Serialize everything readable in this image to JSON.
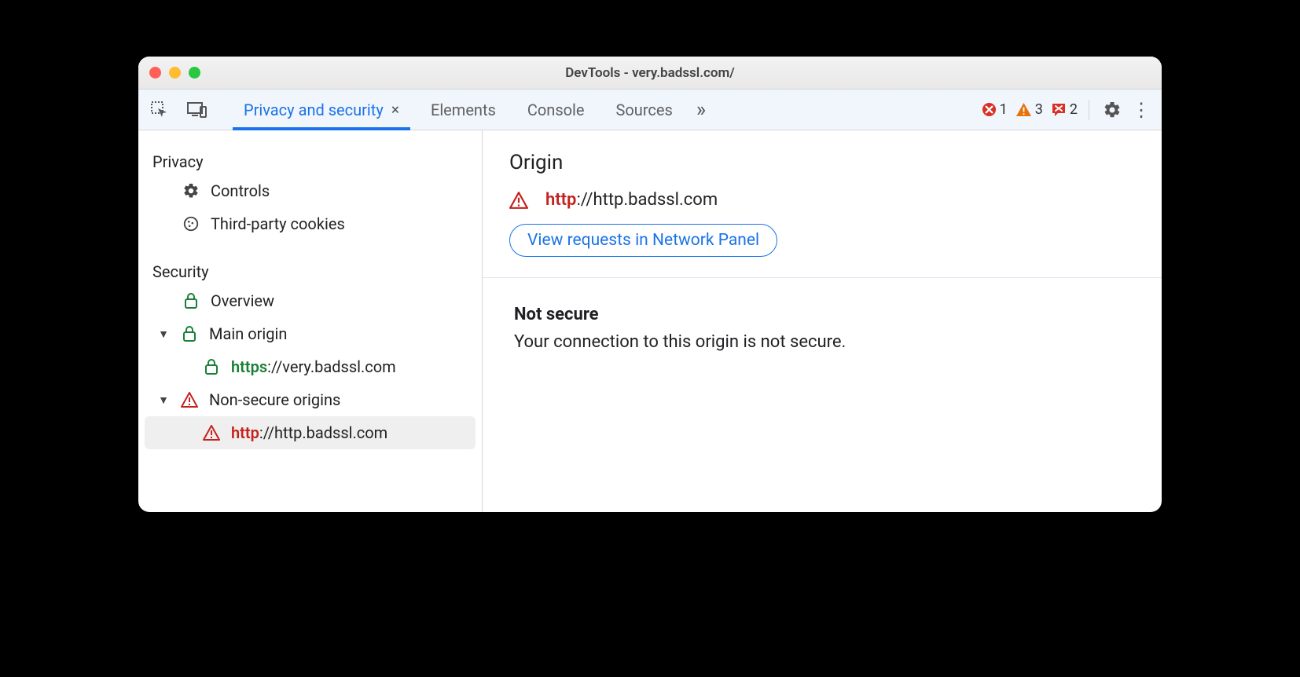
{
  "window_title": "DevTools - very.badssl.com/",
  "tabs": {
    "active": "Privacy and security",
    "others": [
      "Elements",
      "Console",
      "Sources"
    ]
  },
  "status": {
    "errors": "1",
    "warnings": "3",
    "messages": "2"
  },
  "sidebar": {
    "privacy": {
      "title": "Privacy",
      "controls": "Controls",
      "cookies": "Third-party cookies"
    },
    "security": {
      "title": "Security",
      "overview": "Overview",
      "main_origin": "Main origin",
      "main_origin_url_scheme": "https",
      "main_origin_url_rest": "://very.badssl.com",
      "non_secure": "Non-secure origins",
      "non_secure_url_scheme": "http",
      "non_secure_url_rest": "://http.badssl.com"
    }
  },
  "main": {
    "origin_heading": "Origin",
    "origin_scheme": "http",
    "origin_rest": "://http.badssl.com",
    "view_requests": "View requests in Network Panel",
    "not_secure_heading": "Not secure",
    "not_secure_body": "Your connection to this origin is not secure."
  }
}
